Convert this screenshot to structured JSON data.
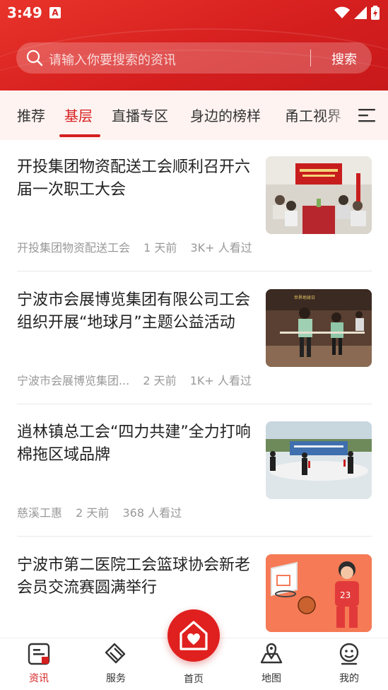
{
  "status_bar": {
    "time": "3:49",
    "app_badge": "A"
  },
  "search": {
    "placeholder": "请输入你要搜索的资讯",
    "button_label": "搜索"
  },
  "tabs": [
    {
      "label": "推荐",
      "active": false
    },
    {
      "label": "基层",
      "active": true
    },
    {
      "label": "直播专区",
      "active": false
    },
    {
      "label": "身边的榜样",
      "active": false
    },
    {
      "label": "甬工视界",
      "active": false
    }
  ],
  "articles": [
    {
      "title": "开投集团物资配送工会顺利召开六届一次职工大会",
      "source": "开投集团物资配送工会",
      "time": "1 天前",
      "views": "3K+ 人看过"
    },
    {
      "title": "宁波市会展博览集团有限公司工会 组织开展“地球月”主题公益活动",
      "source": "宁波市会展博览集团...",
      "time": "2 天前",
      "views": "1K+ 人看过"
    },
    {
      "title": "逍林镇总工会“四力共建”全力打响棉拖区域品牌",
      "source": "慈溪工惠",
      "time": "2 天前",
      "views": "368 人看过"
    },
    {
      "title": "宁波市第二医院工会篮球协会新老会员交流赛圆满举行",
      "source": "",
      "time": "",
      "views": ""
    }
  ],
  "bottom_nav": [
    {
      "label": "资讯",
      "icon": "news-icon",
      "active": true
    },
    {
      "label": "服务",
      "icon": "service-icon",
      "active": false
    },
    {
      "label": "首页",
      "icon": "home-heart-icon",
      "active": false
    },
    {
      "label": "地图",
      "icon": "map-icon",
      "active": false
    },
    {
      "label": "我的",
      "icon": "profile-icon",
      "active": false
    }
  ],
  "colors": {
    "brand_red": "#d61f1f",
    "tab_bg": "#fef3f1",
    "meta_gray": "#999999"
  }
}
